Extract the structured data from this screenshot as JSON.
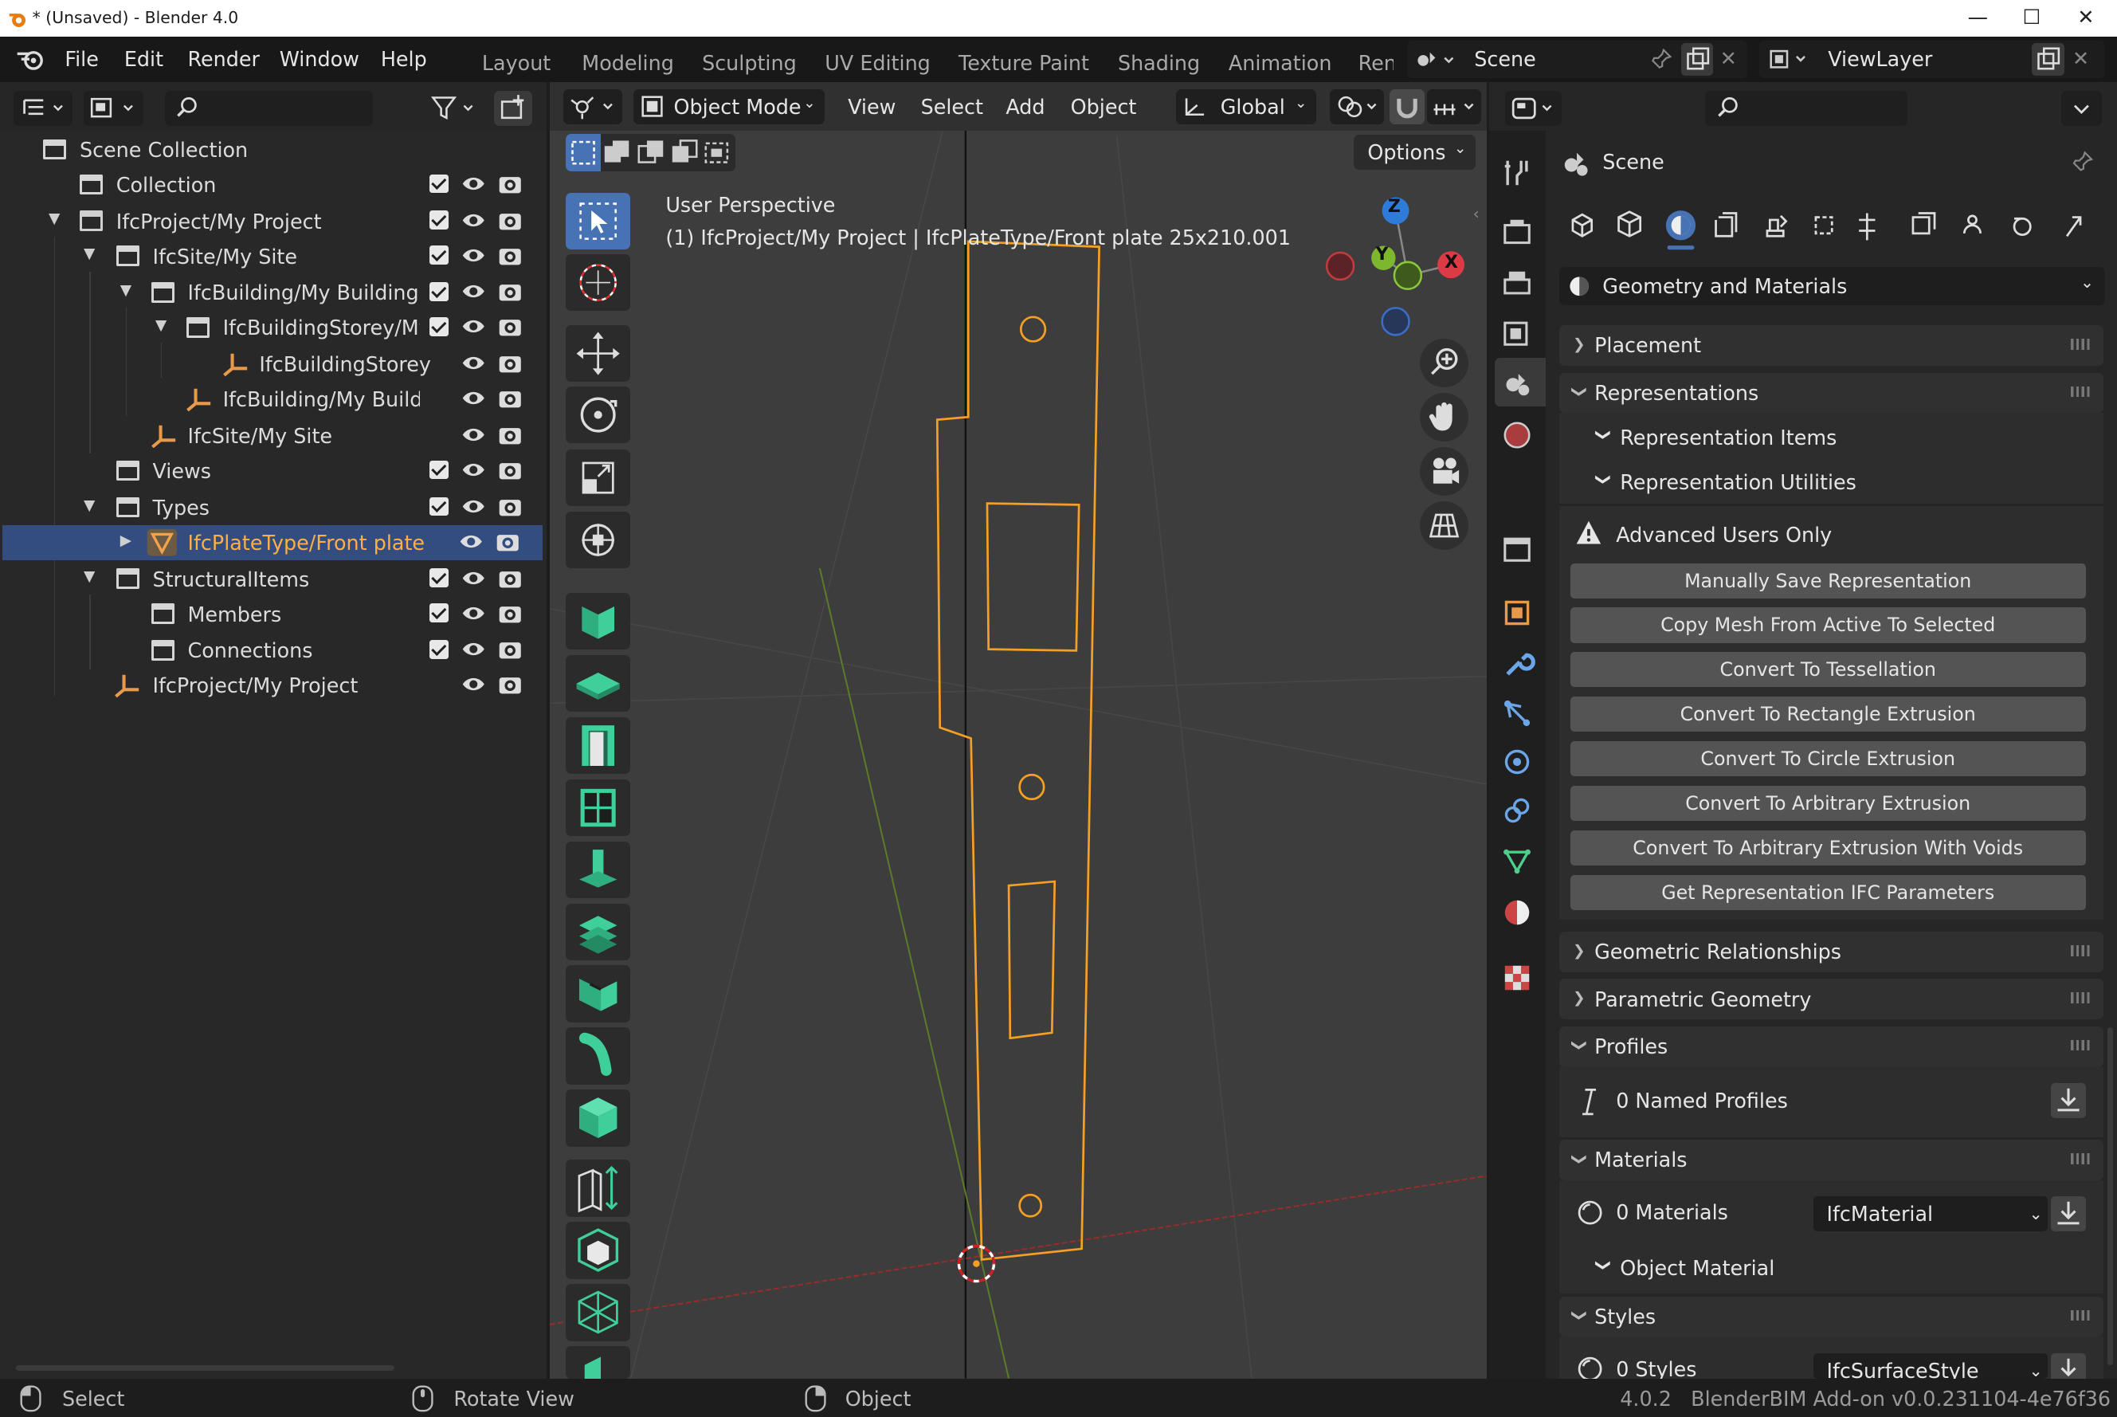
{
  "window": {
    "title": "* (Unsaved) - Blender 4.0",
    "min": "—",
    "max": "☐",
    "close": "✕"
  },
  "menu": [
    "File",
    "Edit",
    "Render",
    "Window",
    "Help"
  ],
  "workspaces": [
    "Layout",
    "Modeling",
    "Sculpting",
    "UV Editing",
    "Texture Paint",
    "Shading",
    "Animation",
    "Ren"
  ],
  "scene": {
    "name": "Scene",
    "view_layer": "ViewLayer"
  },
  "outliner": {
    "rows": [
      {
        "label": "Scene Collection"
      },
      {
        "label": "Collection"
      },
      {
        "label": "IfcProject/My Project"
      },
      {
        "label": "IfcSite/My Site"
      },
      {
        "label": "IfcBuilding/My Building"
      },
      {
        "label": "IfcBuildingStorey/My"
      },
      {
        "label": "IfcBuildingStorey"
      },
      {
        "label": "IfcBuilding/My Buildi"
      },
      {
        "label": "IfcSite/My Site"
      },
      {
        "label": "Views"
      },
      {
        "label": "Types"
      },
      {
        "label": "IfcPlateType/Front plate"
      },
      {
        "label": "StructuralItems"
      },
      {
        "label": "Members"
      },
      {
        "label": "Connections"
      },
      {
        "label": "IfcProject/My Project"
      }
    ]
  },
  "viewport": {
    "mode": "Object Mode",
    "menus": [
      "View",
      "Select",
      "Add",
      "Object"
    ],
    "orientation": "Global",
    "options": "Options",
    "info_line1": "User Perspective",
    "info_line2": "(1) IfcProject/My Project | IfcPlateType/Front plate 25x210.001",
    "axes": {
      "z": "Z",
      "y": "Y",
      "x": "X"
    }
  },
  "properties": {
    "context": "Scene",
    "dropdown": "Geometry and Materials",
    "sections": {
      "placement": "Placement",
      "representations": "Representations",
      "rep_items": "Representation Items",
      "rep_utils": "Representation Utilities",
      "advanced": "Advanced Users Only",
      "geom_rel": "Geometric Relationships",
      "param_geom": "Parametric Geometry",
      "profiles": "Profiles",
      "named_profiles": "0 Named Profiles",
      "materials": "Materials",
      "materials_count": "0 Materials",
      "material_type": "IfcMaterial",
      "object_material": "Object Material",
      "styles": "Styles",
      "styles_count": "0 Styles",
      "style_type": "IfcSurfaceStyle"
    },
    "buttons": [
      "Manually Save Representation",
      "Copy Mesh From Active To Selected",
      "Convert To Tessellation",
      "Convert To Rectangle Extrusion",
      "Convert To Circle Extrusion",
      "Convert To Arbitrary Extrusion",
      "Convert To Arbitrary Extrusion With Voids",
      "Get Representation IFC Parameters"
    ]
  },
  "status": {
    "select": "Select",
    "rotate": "Rotate View",
    "object": "Object",
    "version": "4.0.2   BlenderBIM Add-on v0.0.231104-4e76f36"
  },
  "colors": {
    "accent": "#4772b3",
    "selection": "#f0a040",
    "tool_green": "#3fbf94"
  }
}
